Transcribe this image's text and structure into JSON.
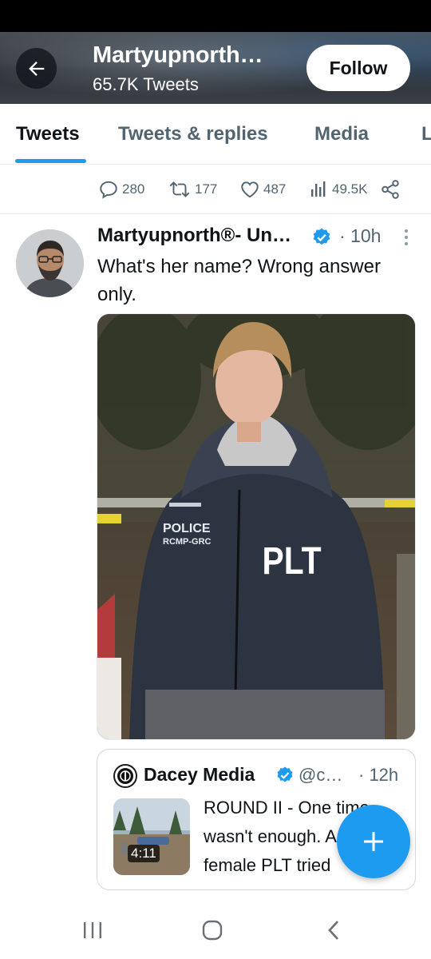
{
  "header": {
    "title": "Martyupnorth…",
    "subtitle": "65.7K Tweets",
    "follow_label": "Follow"
  },
  "tabs": [
    {
      "label": "Tweets",
      "active": true
    },
    {
      "label": "Tweets & replies",
      "active": false
    },
    {
      "label": "Media",
      "active": false
    },
    {
      "label": "L",
      "active": false
    }
  ],
  "previous_tweet_actions": {
    "replies": "280",
    "retweets": "177",
    "likes": "487",
    "views": "49.5K"
  },
  "tweet": {
    "author": "Martyupnorth®- Un…",
    "time": "· 10h",
    "text_line1": "What's her name?  Wrong answer",
    "text_line2": "only.",
    "media": {
      "jacket_text_police": "POLICE",
      "jacket_text_rcmp": "RCMP-GRC",
      "jacket_text_plt": "PLT"
    }
  },
  "quote": {
    "name": "Dacey Media",
    "handle": "@c…",
    "time": "· 12h",
    "video_duration": "4:11",
    "text_line1": "ROUND II - One time",
    "text_line2": "wasn't enough. A",
    "text_line3": "female PLT tried"
  },
  "colors": {
    "accent": "#1d9bf0",
    "text_primary": "#0f1419",
    "text_secondary": "#536471"
  },
  "icons": [
    "back-arrow-icon",
    "reply-icon",
    "retweet-icon",
    "like-icon",
    "views-icon",
    "share-icon",
    "verified-badge-icon",
    "more-icon",
    "compose-plus-icon",
    "recent-apps-icon",
    "home-icon",
    "back-icon"
  ]
}
